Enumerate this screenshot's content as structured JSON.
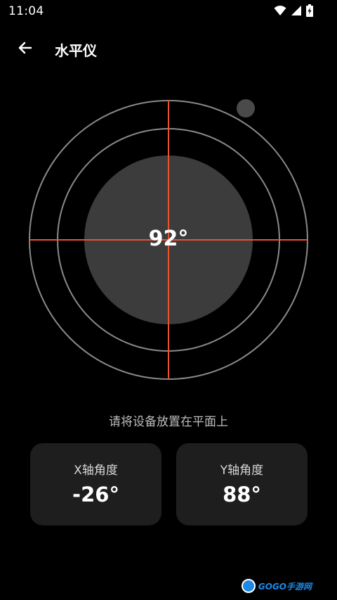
{
  "status_bar": {
    "time": "11:04",
    "icons": [
      "wifi-icon",
      "signal-icon",
      "battery-charging-icon"
    ]
  },
  "app_bar": {
    "back_icon": "arrow-left-icon",
    "title": "水平仪"
  },
  "gauge": {
    "angle": "92°",
    "crosshair_color": "#e8532f",
    "disc_color": "#3c3c3c",
    "ring_color": "#8a8a8a",
    "bubble_color": "#4a4a4a"
  },
  "hint": "请将设备放置在平面上",
  "x_card": {
    "label": "X轴角度",
    "value": "-26°"
  },
  "y_card": {
    "label": "Y轴角度",
    "value": "88°"
  },
  "watermark": {
    "text": "GOGO手游网"
  }
}
